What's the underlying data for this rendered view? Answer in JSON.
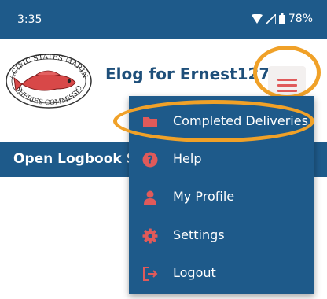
{
  "status_bar": {
    "time": "3:35",
    "battery": "78%"
  },
  "header": {
    "title": "Elog for Ernest127",
    "logo": {
      "top_text": "PACIFIC STATES MARINE",
      "bottom_text": "FISHERIES COMMISSION"
    },
    "menu_icon": "hamburger-icon"
  },
  "sub_bar": {
    "title": "Open Logbook S"
  },
  "menu": {
    "items": [
      {
        "label": "Completed Deliveries",
        "icon": "folder-icon"
      },
      {
        "label": "Help",
        "icon": "help-circle-icon"
      },
      {
        "label": "My Profile",
        "icon": "person-icon"
      },
      {
        "label": "Settings",
        "icon": "gear-icon"
      },
      {
        "label": "Logout",
        "icon": "logout-icon"
      }
    ]
  },
  "colors": {
    "primary": "#1e5a8a",
    "icon_accent": "#e05a5a",
    "highlight": "#f0a128"
  }
}
